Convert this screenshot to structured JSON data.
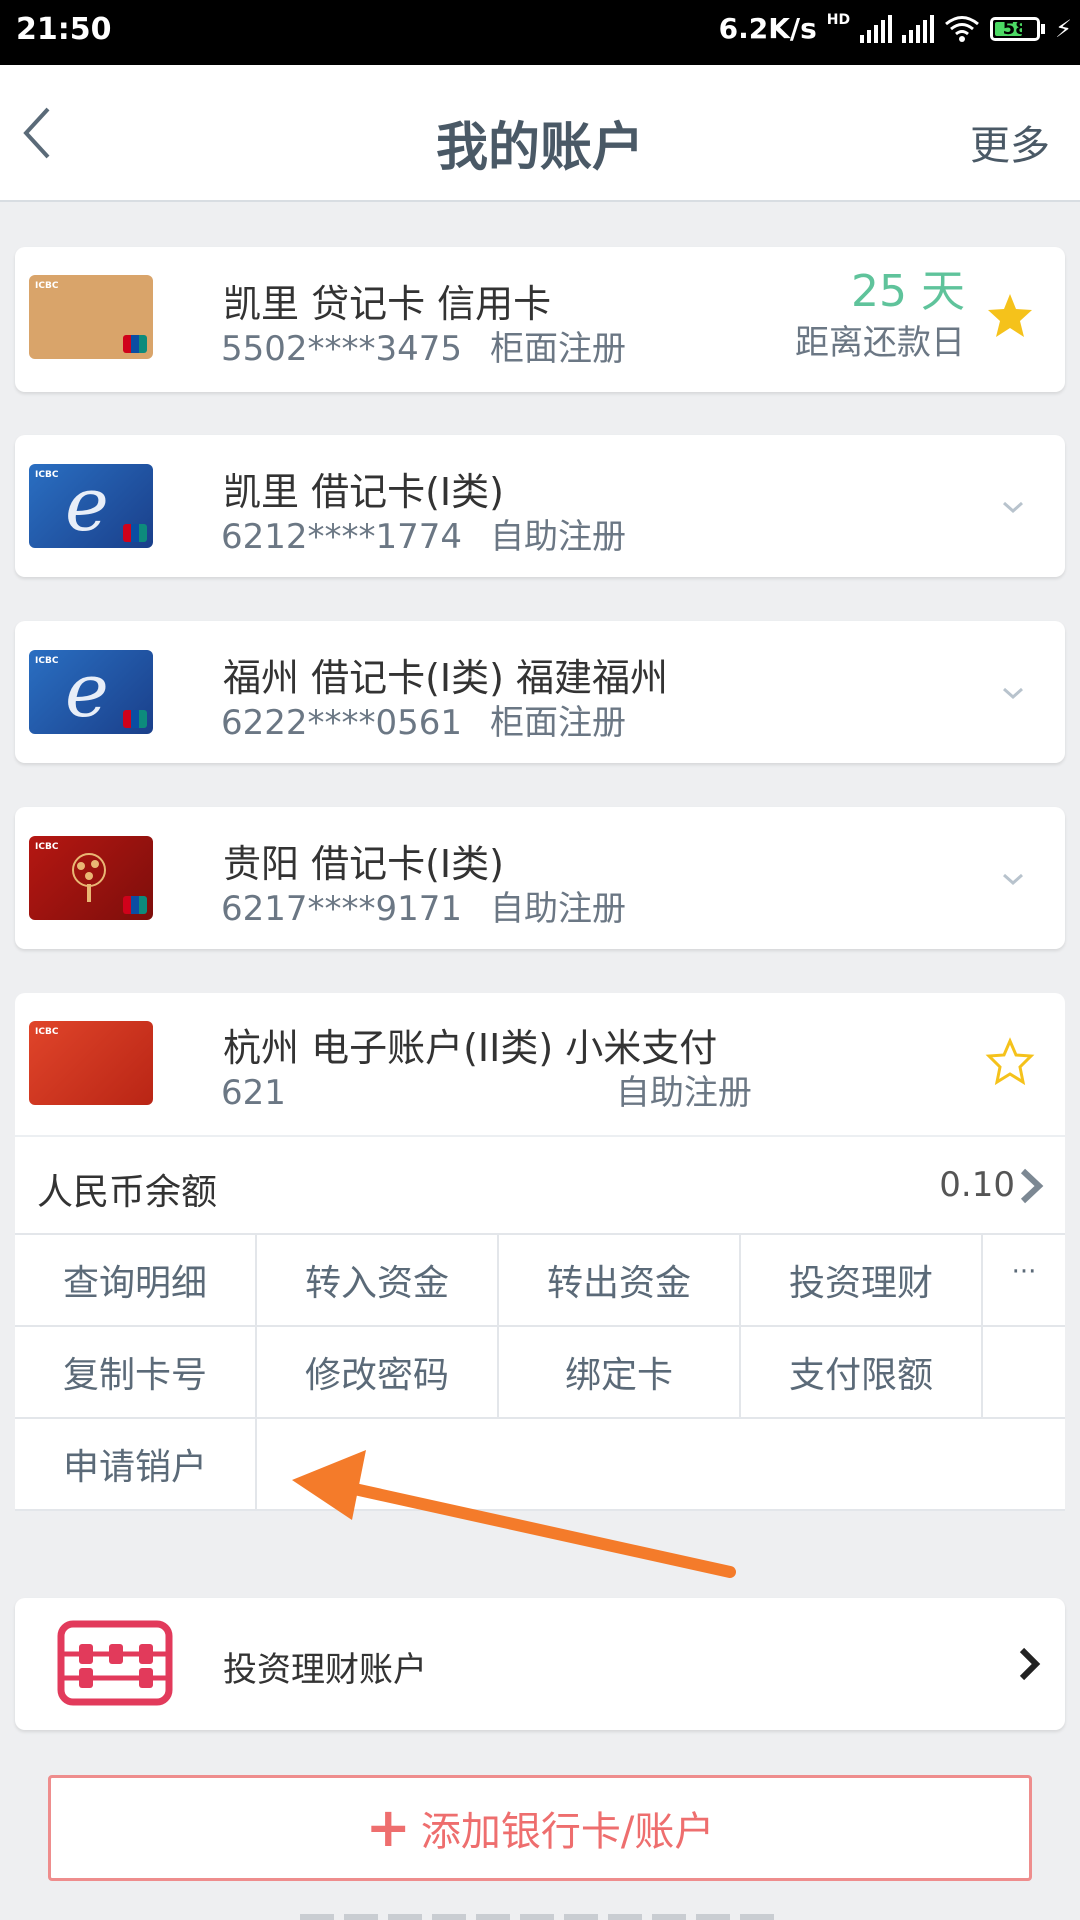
{
  "status_bar": {
    "time": "21:50",
    "net_speed": "6.2K/s",
    "network_tag": "HD",
    "battery": "58"
  },
  "nav": {
    "title": "我的账户",
    "more": "更多"
  },
  "cards": [
    {
      "title": "凯里 贷记卡 信用卡",
      "number": "5502****3475",
      "registration": "柜面注册",
      "days_value": "25 天",
      "days_label": "距离还款日"
    },
    {
      "title": "凯里 借记卡(I类)",
      "number": "6212****1774",
      "registration": "自助注册"
    },
    {
      "title": "福州 借记卡(I类) 福建福州",
      "number": "6222****0561",
      "registration": "柜面注册"
    },
    {
      "title": "贵阳 借记卡(I类)",
      "number": "6217****9171",
      "registration": "自助注册"
    },
    {
      "title": "杭州 电子账户(II类) 小米支付",
      "number": "621",
      "registration": "自助注册"
    }
  ],
  "expanded": {
    "balance_label": "人民币余额",
    "balance_value": "0.10",
    "actions_row1": [
      "查询明细",
      "转入资金",
      "转出资金",
      "投资理财"
    ],
    "more_symbol": "···",
    "actions_row2": [
      "复制卡号",
      "修改密码",
      "绑定卡",
      "支付限额"
    ],
    "actions_row3": [
      "申请销户"
    ]
  },
  "invest": {
    "label": "投资理财账户"
  },
  "add_button": {
    "plus": "+",
    "label": "添加银行卡/账户"
  },
  "colors": {
    "accent_green": "#5fc39b",
    "star_gold": "#f5c21b",
    "add_red": "#ee6e6e",
    "arrow_orange": "#f47b2a",
    "invest_icon": "#e23a5b"
  }
}
